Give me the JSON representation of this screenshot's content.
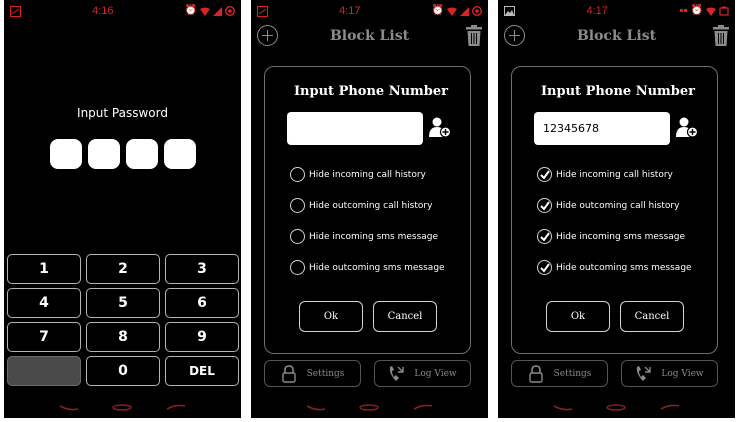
{
  "screens": {
    "lock": {
      "status": {
        "time": "4:16"
      },
      "password_label": "Input Password",
      "password_digits": 4,
      "keys": [
        "1",
        "2",
        "3",
        "4",
        "5",
        "6",
        "7",
        "8",
        "9",
        "",
        "0",
        "DEL"
      ]
    },
    "empty": {
      "status": {
        "time": "4:17"
      },
      "title": "Block List",
      "dialog": {
        "title": "Input Phone Number",
        "phone_value": "",
        "options": [
          {
            "label": "Hide incoming call history",
            "checked": false
          },
          {
            "label": "Hide outcoming call history",
            "checked": false
          },
          {
            "label": "Hide incoming sms message",
            "checked": false
          },
          {
            "label": "Hide outcoming sms message",
            "checked": false
          }
        ],
        "ok_label": "Ok",
        "cancel_label": "Cancel"
      },
      "settings_label": "Settings",
      "log_label": "Log View"
    },
    "filled": {
      "status": {
        "time": "4:17"
      },
      "title": "Block List",
      "dialog": {
        "title": "Input Phone Number",
        "phone_value": "12345678",
        "options": [
          {
            "label": "Hide incoming call history",
            "checked": true
          },
          {
            "label": "Hide outcoming call history",
            "checked": true
          },
          {
            "label": "Hide incoming sms message",
            "checked": true
          },
          {
            "label": "Hide outcoming sms message",
            "checked": true
          }
        ],
        "ok_label": "Ok",
        "cancel_label": "Cancel"
      },
      "settings_label": "Settings",
      "log_label": "Log View"
    }
  },
  "icons": {
    "status_left": "notification-icon",
    "status_right": [
      "alarm-icon",
      "wifi-icon",
      "signal-icon",
      "battery-icon"
    ],
    "nav": [
      "back-icon",
      "home-icon",
      "recent-apps-icon"
    ]
  },
  "colors": {
    "accent_red": "#d8232a",
    "screen_bg": "#000000",
    "muted": "#8c8c8c"
  }
}
